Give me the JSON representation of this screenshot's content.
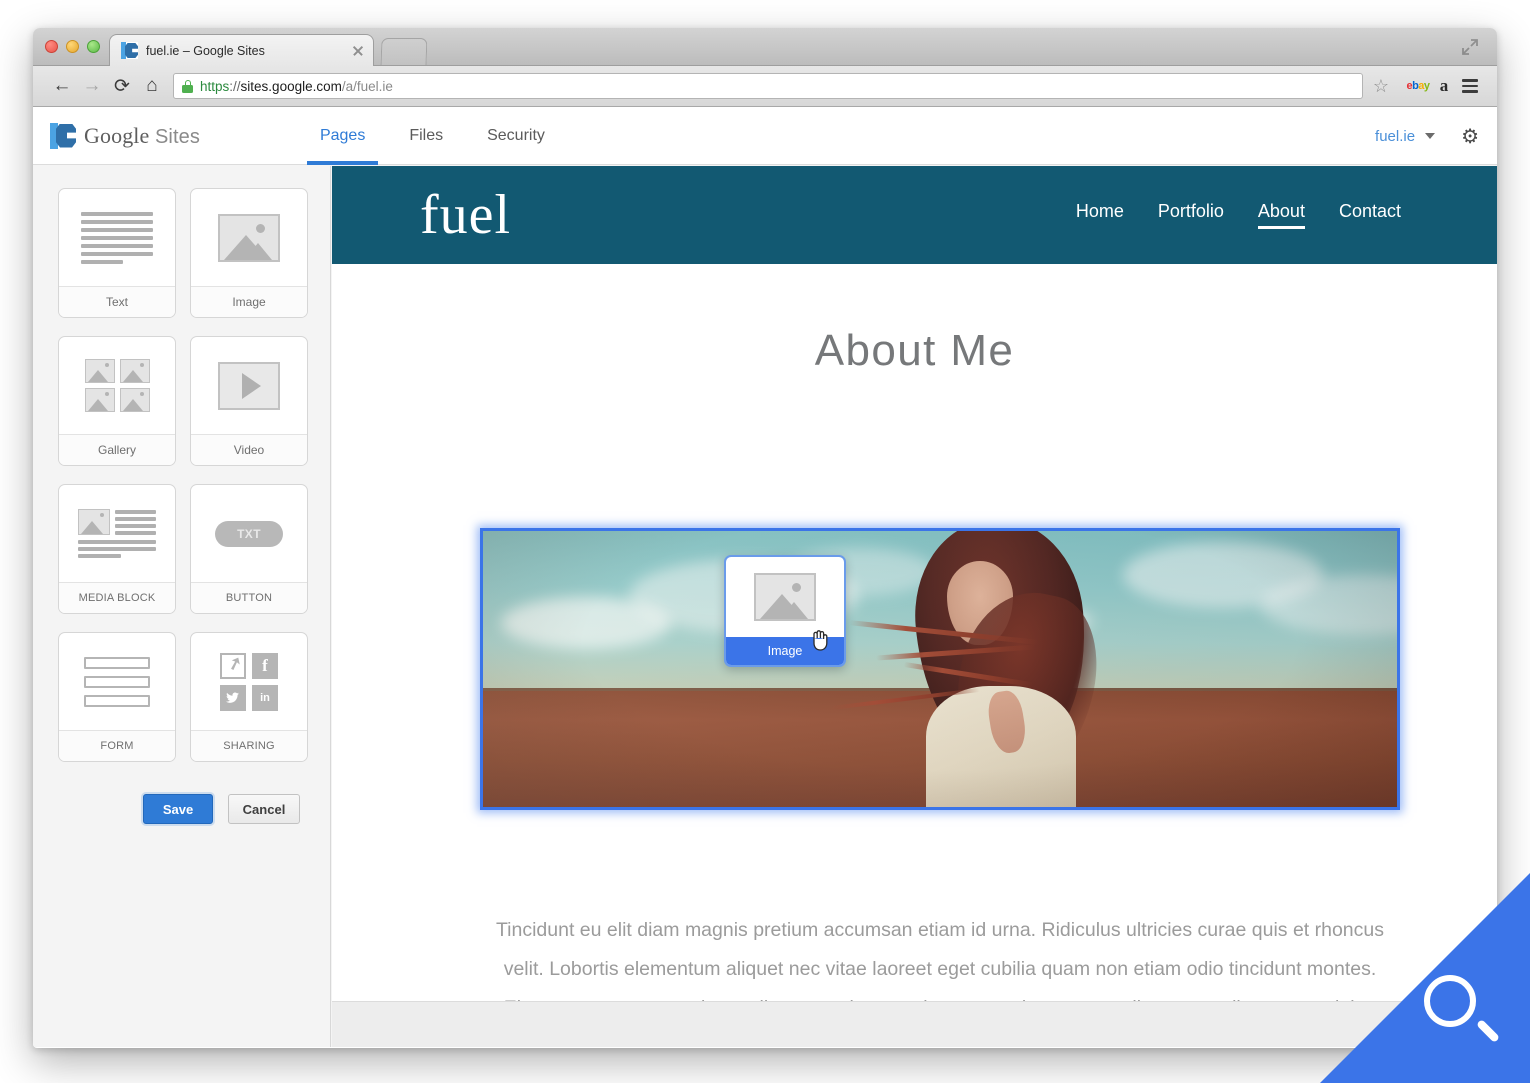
{
  "browser": {
    "tab": {
      "title": "fuel.ie – Google Sites",
      "favicon": "google-sites-favicon",
      "close": "×"
    },
    "new_tab_label": "",
    "nav": {
      "back": "←",
      "forward": "→",
      "reload": "⟳",
      "home": "⌂"
    },
    "url": {
      "scheme": "https",
      "separator": "://",
      "host": "sites.google.com",
      "path": "/a/fuel.ie",
      "lock": "secure-lock-icon"
    },
    "bookmark_star": "☆",
    "extensions": [
      {
        "name": "ebay-extension-icon",
        "letters": [
          "e",
          "b",
          "a",
          "y"
        ]
      },
      {
        "name": "amazon-extension-icon",
        "label": "a"
      }
    ],
    "menu": "chrome-menu-icon",
    "expand": "fullscreen-icon"
  },
  "sites_app": {
    "logo": {
      "word": "Google",
      "light": "Sites"
    },
    "tabs": [
      {
        "label": "Pages",
        "active": true
      },
      {
        "label": "Files",
        "active": false
      },
      {
        "label": "Security",
        "active": false
      }
    ],
    "account": {
      "name": "fuel.ie",
      "caret": "▾",
      "settings": "⚙"
    },
    "accent_color": "#2f7bd6"
  },
  "sidebar": {
    "widgets": [
      {
        "label": "Text",
        "icon": "text-lines-icon",
        "caps": false
      },
      {
        "label": "Image",
        "icon": "image-placeholder-icon",
        "caps": false
      },
      {
        "label": "Gallery",
        "icon": "gallery-grid-icon",
        "caps": false
      },
      {
        "label": "Video",
        "icon": "video-play-icon",
        "caps": false
      },
      {
        "label": "MEDIA BLOCK",
        "icon": "media-block-icon",
        "caps": true
      },
      {
        "label": "BUTTON",
        "icon": "button-pill-icon",
        "caps": true
      },
      {
        "label": "FORM",
        "icon": "form-fields-icon",
        "caps": true
      },
      {
        "label": "SHARING",
        "icon": "social-sharing-icon",
        "caps": true
      }
    ],
    "button_tile_text": "TXT",
    "social_icons": [
      "share-arrow-icon",
      "facebook-icon",
      "twitter-icon",
      "linkedin-icon"
    ],
    "actions": {
      "save": "Save",
      "cancel": "Cancel"
    }
  },
  "drag": {
    "label": "Image",
    "icon": "image-placeholder-icon",
    "cursor": "grabbing-hand-cursor"
  },
  "site_preview": {
    "logo": "fuel",
    "header_color": "#125972",
    "nav": [
      {
        "label": "Home",
        "active": false
      },
      {
        "label": "Portfolio",
        "active": false
      },
      {
        "label": "About",
        "active": true
      },
      {
        "label": "Contact",
        "active": false
      }
    ],
    "page_title": "About Me",
    "hero_image_alt": "woman-with-windblown-hair-in-field-photo",
    "body_text": "Tincidunt eu elit diam magnis pretium accumsan etiam id urna. Ridiculus ultricies curae quis et rhoncus velit. Lobortis elementum aliquet nec vitae laoreet eget cubilia quam non etiam odio tincidunt montes. Elementum sem parturient nulla quam placerat viverra mauris non cum elit tempus ullamcorper dolor. Libero rutrum ut lacinia donec curae mus vel quisque sociis nec ornare iaculis."
  },
  "overlay": {
    "magnifier": "magnifying-glass-icon",
    "color": "#3b74e8"
  }
}
